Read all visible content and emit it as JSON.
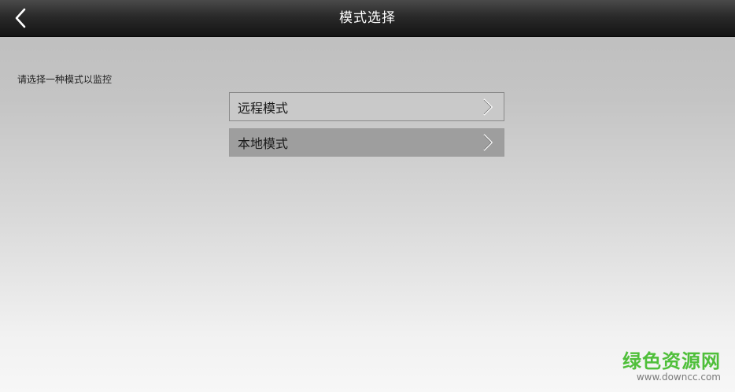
{
  "header": {
    "title": "模式选择",
    "back_icon": "chevron-left-icon"
  },
  "prompt": "请选择一种模式以监控",
  "modes": [
    {
      "label": "远程模式",
      "icon": "chevron-right-icon"
    },
    {
      "label": "本地模式",
      "icon": "chevron-right-icon"
    }
  ],
  "watermark": {
    "name": "绿色资源网",
    "url": "www.downcc.com"
  },
  "colors": {
    "header_bg": "#1e1e1e",
    "remote_item_bg": "#c9c9c9",
    "local_item_bg": "#9e9e9e",
    "watermark_green": "#4fbf3a"
  }
}
